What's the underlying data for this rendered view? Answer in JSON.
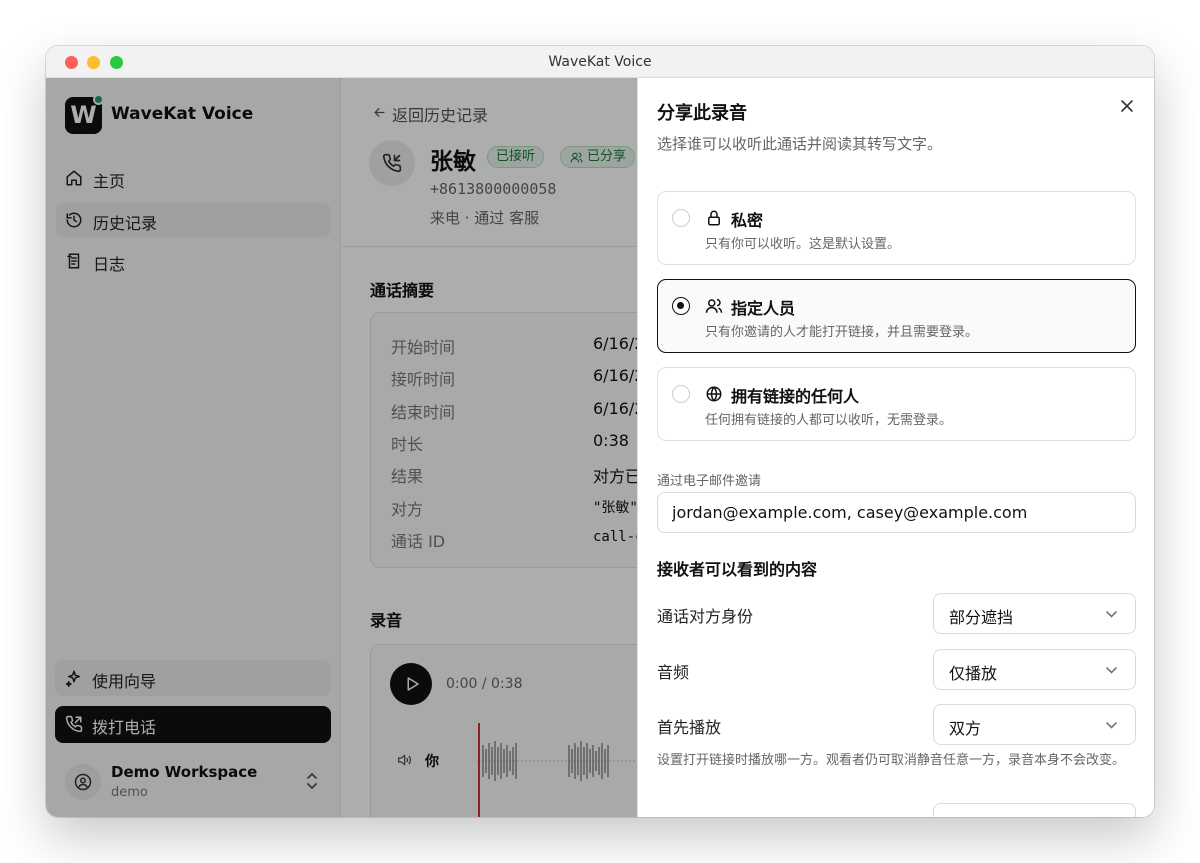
{
  "window": {
    "title": "WaveKat Voice"
  },
  "sidebar": {
    "logo_letter": "W",
    "brand": "WaveKat Voice",
    "nav": [
      {
        "label": "主页",
        "icon": "home-icon"
      },
      {
        "label": "历史记录",
        "icon": "history-icon",
        "active": true
      },
      {
        "label": "日志",
        "icon": "log-icon"
      }
    ],
    "guide_label": "使用向导",
    "dial_label": "拨打电话",
    "workspace": {
      "name": "Demo Workspace",
      "sub": "demo"
    }
  },
  "call": {
    "back_label": "返回历史记录",
    "name": "张敏",
    "badges": {
      "answered": "已接听",
      "shared": "已分享"
    },
    "phone": "+8613800000058",
    "meta": "来电 · 通过 客服",
    "summary_title": "通话摘要",
    "summary": [
      {
        "label": "开始时间",
        "value": "6/16/2"
      },
      {
        "label": "接听时间",
        "value": "6/16/2"
      },
      {
        "label": "结束时间",
        "value": "6/16/2"
      },
      {
        "label": "时长",
        "value": "0:38"
      },
      {
        "label": "结果",
        "value": "对方已"
      },
      {
        "label": "对方",
        "value": "\"张敏\""
      },
      {
        "label": "通话 ID",
        "value": "call-c"
      }
    ],
    "recording_title": "录音",
    "time": "0:00 / 0:38",
    "track_label": "你"
  },
  "share": {
    "title": "分享此录音",
    "description": "选择谁可以收听此通话并阅读其转写文字。",
    "options": [
      {
        "title": "私密",
        "desc": "只有你可以收听。这是默认设置。",
        "icon": "lock-icon",
        "selected": false
      },
      {
        "title": "指定人员",
        "desc": "只有你邀请的人才能打开链接，并且需要登录。",
        "icon": "users-icon",
        "selected": true
      },
      {
        "title": "拥有链接的任何人",
        "desc": "任何拥有链接的人都可以收听，无需登录。",
        "icon": "globe-icon",
        "selected": false
      }
    ],
    "email_label": "通过电子邮件邀请",
    "email_value": "jordan@example.com, casey@example.com",
    "visible_title": "接收者可以看到的内容",
    "settings": [
      {
        "label": "通话对方身份",
        "value": "部分遮挡"
      },
      {
        "label": "音频",
        "value": "仅播放"
      },
      {
        "label": "首先播放",
        "value": "双方"
      }
    ],
    "hint": "设置打开链接时播放哪一方。观看者仍可取消静音任意一方，录音本身不会改变。"
  },
  "colors": {
    "accent": "#111111",
    "success": "#22a06b",
    "playhead": "#d0302f"
  }
}
